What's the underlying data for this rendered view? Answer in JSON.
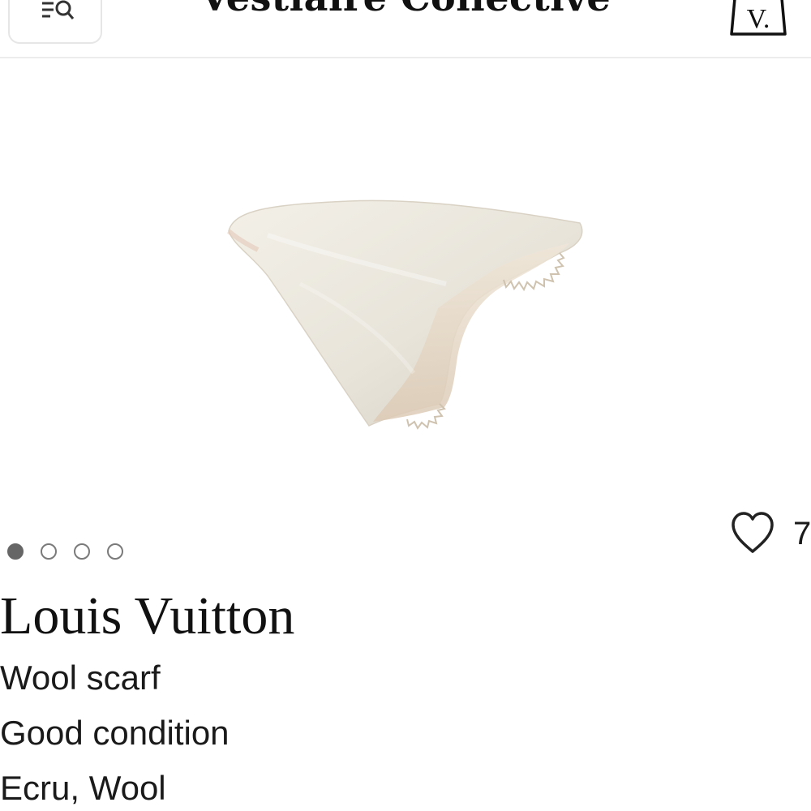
{
  "header": {
    "title": "Vestiaire Collective",
    "menu_icon": "menu-search-icon",
    "bag_icon": "shopping-bag-icon",
    "bag_letter": "V."
  },
  "product": {
    "image_icon": "scarf-photo",
    "carousel": {
      "total": 4,
      "active_index": 0
    },
    "favorite": {
      "icon": "heart-icon",
      "count": "7"
    },
    "brand": "Louis Vuitton",
    "name": "Wool scarf",
    "condition": "Good condition",
    "material": "Ecru, Wool"
  },
  "colors": {
    "text": "#1a1a1a",
    "dot_active": "#666666",
    "divider": "#ececec"
  }
}
